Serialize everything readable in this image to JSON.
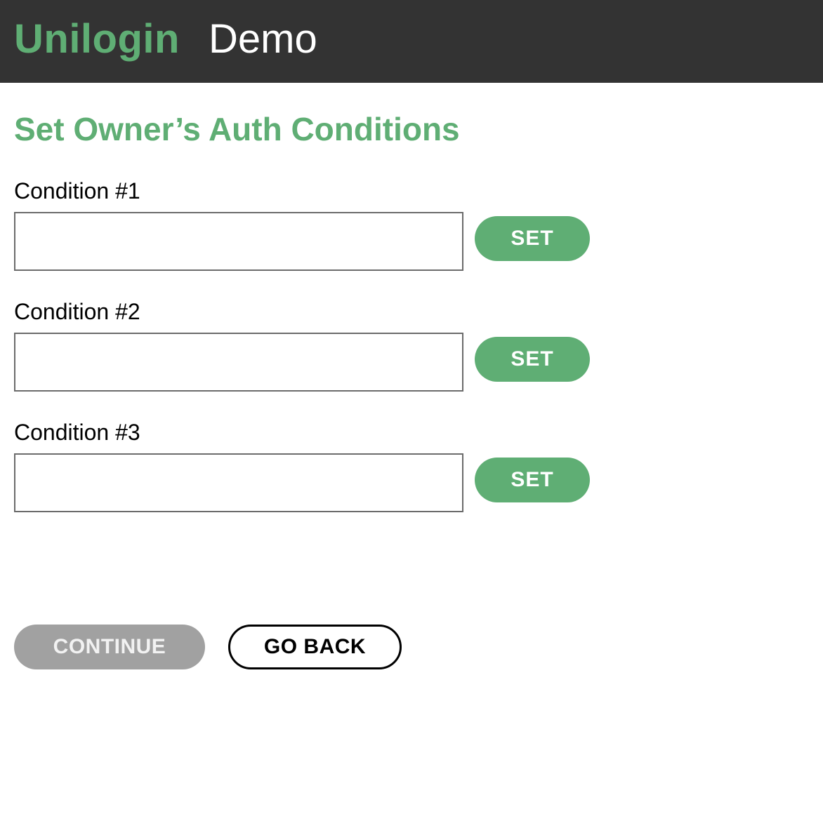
{
  "header": {
    "brand": "Unilogin",
    "brand_sub": "Demo"
  },
  "page": {
    "title": "Set Owner’s Auth Conditions"
  },
  "conditions": [
    {
      "label": "Condition #1",
      "value": "",
      "placeholder": "",
      "button_label": "SET"
    },
    {
      "label": "Condition #2",
      "value": "",
      "placeholder": "",
      "button_label": "SET"
    },
    {
      "label": "Condition #3",
      "value": "",
      "placeholder": "",
      "button_label": "SET"
    }
  ],
  "actions": {
    "continue_label": "CONTINUE",
    "go_back_label": "GO BACK"
  },
  "colors": {
    "header_bg": "#333333",
    "accent": "#5fae74",
    "disabled": "#a1a1a1"
  }
}
